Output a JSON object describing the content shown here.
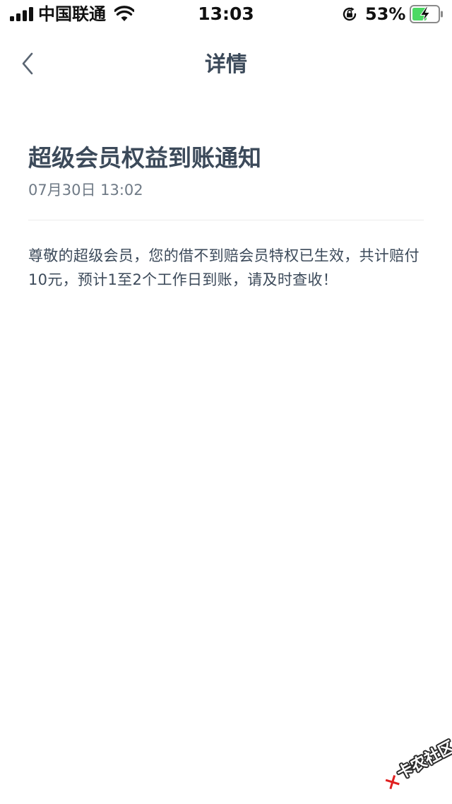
{
  "status_bar": {
    "carrier": "中国联通",
    "time": "13:03",
    "battery_percent": "53%",
    "icons": [
      "signal-icon",
      "wifi-icon",
      "rotation-lock-icon",
      "battery-charging-icon"
    ]
  },
  "nav": {
    "title": "详情",
    "back_icon": "chevron-left-icon"
  },
  "article": {
    "title": "超级会员权益到账通知",
    "date": "07月30日 13:02",
    "body": "尊敬的超级会员，您的借不到赔会员特权已生效，共计赔付 10元，预计1至2个工作日到账，请及时查收！"
  },
  "watermark": {
    "text": "卡农社区"
  },
  "colors": {
    "text_primary": "#3c4a5a",
    "text_secondary": "#6f7a86",
    "divider": "#ececec",
    "battery_fill": "#4cd964",
    "watermark_icon": "#e02020"
  }
}
